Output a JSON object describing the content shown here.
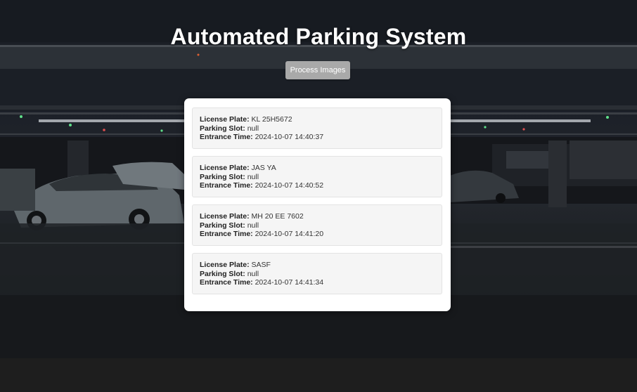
{
  "page": {
    "title": "Automated Parking System",
    "process_button": "Process Images"
  },
  "labels": {
    "license_plate": "License Plate:",
    "parking_slot": "Parking Slot:",
    "entrance_time": "Entrance Time:"
  },
  "records": [
    {
      "license_plate": "KL 25H5672",
      "parking_slot": "null",
      "entrance_time": "2024-10-07 14:40:37"
    },
    {
      "license_plate": "JAS YA",
      "parking_slot": "null",
      "entrance_time": "2024-10-07 14:40:52"
    },
    {
      "license_plate": "MH 20 EE 7602",
      "parking_slot": "null",
      "entrance_time": "2024-10-07 14:41:20"
    },
    {
      "license_plate": "SASF",
      "parking_slot": "null",
      "entrance_time": "2024-10-07 14:41:34"
    }
  ],
  "colors": {
    "button_bg": "#a9a9a9",
    "panel_bg": "#ffffff",
    "record_bg": "#f5f5f5",
    "page_bottom": "#1e1e1e"
  }
}
